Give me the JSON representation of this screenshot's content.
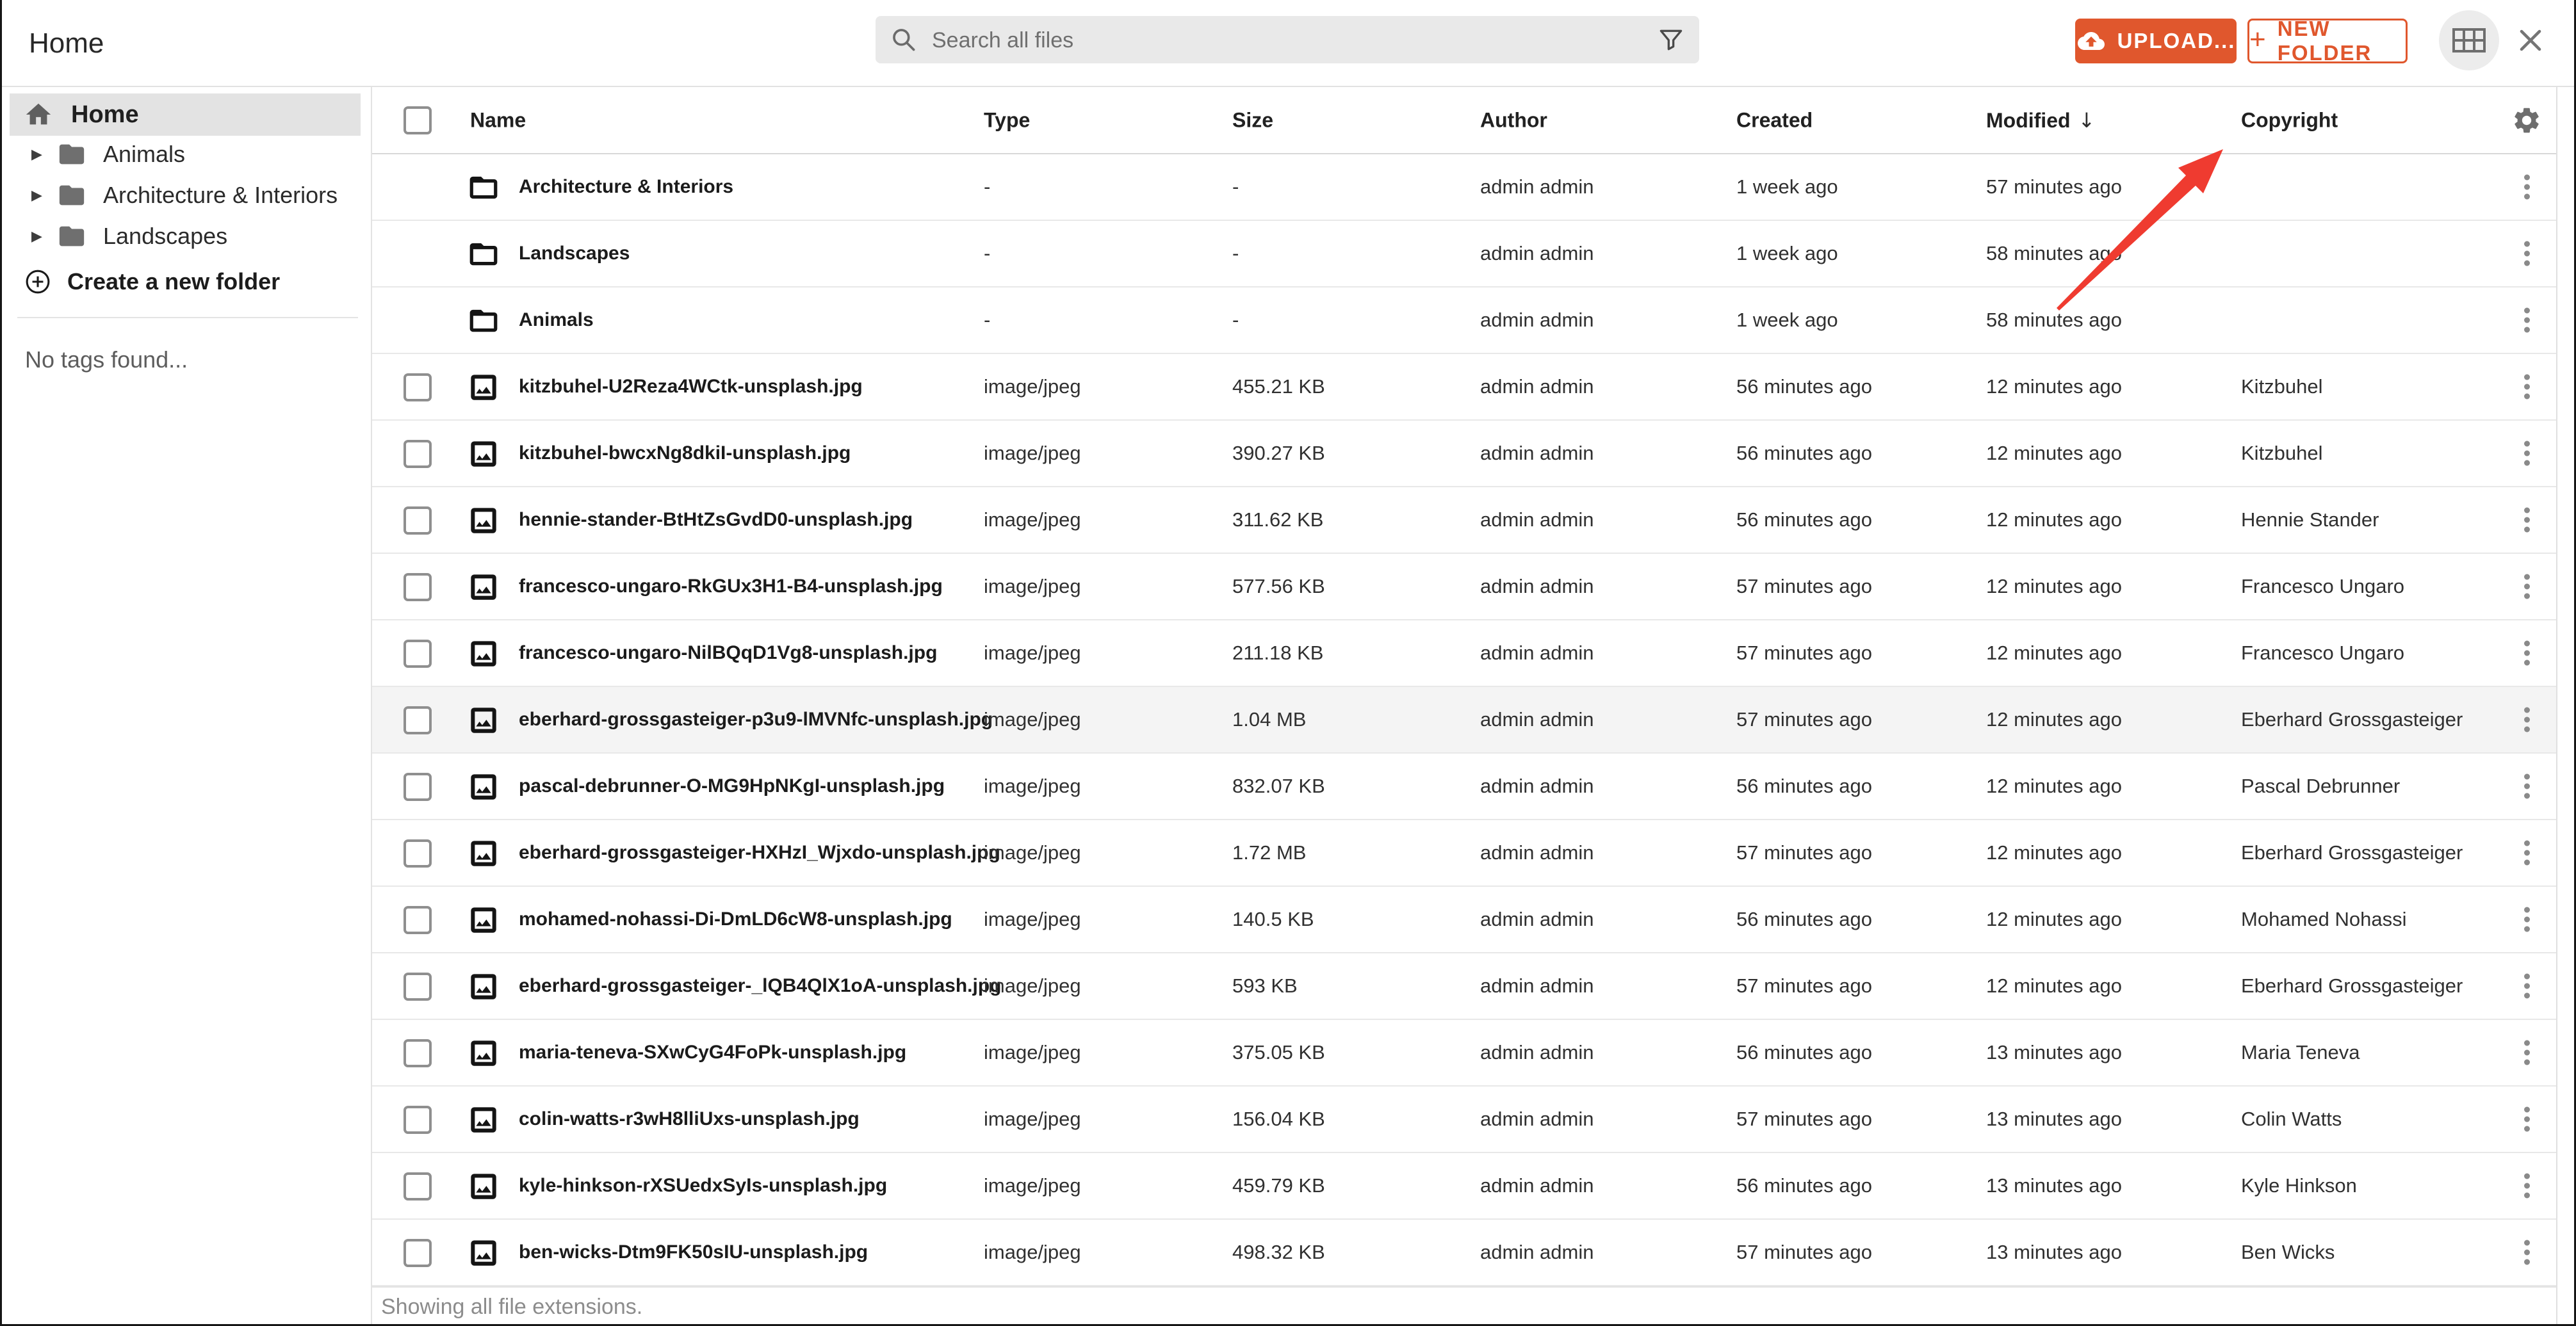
{
  "colors": {
    "accent": "#e0572d",
    "arrow_red": "#ef3b30",
    "selected_bg": "#e3e3e3",
    "hover_row_bg": "#f4f4f4"
  },
  "topbar": {
    "title": "Home",
    "search": {
      "placeholder": "Search all files",
      "value": ""
    },
    "upload_label": "UPLOAD...",
    "new_folder_plus": "+",
    "new_folder_label": "NEW FOLDER"
  },
  "icons": {
    "caret_right": "▶",
    "sort_desc": "↓"
  },
  "sidebar": {
    "home_label": "Home",
    "tree": [
      {
        "label": "Animals"
      },
      {
        "label": "Architecture & Interiors"
      },
      {
        "label": "Landscapes"
      }
    ],
    "create_folder_label": "Create a new folder",
    "no_tags_label": "No tags found..."
  },
  "table": {
    "columns": [
      "Name",
      "Type",
      "Size",
      "Author",
      "Created",
      "Modified",
      "Copyright"
    ],
    "sort_column": "Modified",
    "sort_direction": "desc",
    "rows": [
      {
        "kind": "folder",
        "name": "Architecture & Interiors",
        "type": "-",
        "size": "-",
        "author": "admin admin",
        "created": "1 week ago",
        "modified": "57 minutes ago",
        "copyright": "",
        "highlighted": false
      },
      {
        "kind": "folder",
        "name": "Landscapes",
        "type": "-",
        "size": "-",
        "author": "admin admin",
        "created": "1 week ago",
        "modified": "58 minutes ago",
        "copyright": "",
        "highlighted": false
      },
      {
        "kind": "folder",
        "name": "Animals",
        "type": "-",
        "size": "-",
        "author": "admin admin",
        "created": "1 week ago",
        "modified": "58 minutes ago",
        "copyright": "",
        "highlighted": false
      },
      {
        "kind": "file",
        "name": "kitzbuhel-U2Reza4WCtk-unsplash.jpg",
        "type": "image/jpeg",
        "size": "455.21 KB",
        "author": "admin admin",
        "created": "56 minutes ago",
        "modified": "12 minutes ago",
        "copyright": "Kitzbuhel",
        "highlighted": false
      },
      {
        "kind": "file",
        "name": "kitzbuhel-bwcxNg8dkiI-unsplash.jpg",
        "type": "image/jpeg",
        "size": "390.27 KB",
        "author": "admin admin",
        "created": "56 minutes ago",
        "modified": "12 minutes ago",
        "copyright": "Kitzbuhel",
        "highlighted": false
      },
      {
        "kind": "file",
        "name": "hennie-stander-BtHtZsGvdD0-unsplash.jpg",
        "type": "image/jpeg",
        "size": "311.62 KB",
        "author": "admin admin",
        "created": "56 minutes ago",
        "modified": "12 minutes ago",
        "copyright": "Hennie Stander",
        "highlighted": false
      },
      {
        "kind": "file",
        "name": "francesco-ungaro-RkGUx3H1-B4-unsplash.jpg",
        "type": "image/jpeg",
        "size": "577.56 KB",
        "author": "admin admin",
        "created": "57 minutes ago",
        "modified": "12 minutes ago",
        "copyright": "Francesco Ungaro",
        "highlighted": false
      },
      {
        "kind": "file",
        "name": "francesco-ungaro-NilBQqD1Vg8-unsplash.jpg",
        "type": "image/jpeg",
        "size": "211.18 KB",
        "author": "admin admin",
        "created": "57 minutes ago",
        "modified": "12 minutes ago",
        "copyright": "Francesco Ungaro",
        "highlighted": false
      },
      {
        "kind": "file",
        "name": "eberhard-grossgasteiger-p3u9-lMVNfc-unsplash.jpg",
        "type": "image/jpeg",
        "size": "1.04 MB",
        "author": "admin admin",
        "created": "57 minutes ago",
        "modified": "12 minutes ago",
        "copyright": "Eberhard Grossgasteiger",
        "highlighted": true
      },
      {
        "kind": "file",
        "name": "pascal-debrunner-O-MG9HpNKgI-unsplash.jpg",
        "type": "image/jpeg",
        "size": "832.07 KB",
        "author": "admin admin",
        "created": "56 minutes ago",
        "modified": "12 minutes ago",
        "copyright": "Pascal Debrunner",
        "highlighted": false
      },
      {
        "kind": "file",
        "name": "eberhard-grossgasteiger-HXHzI_Wjxdo-unsplash.jpg",
        "type": "image/jpeg",
        "size": "1.72 MB",
        "author": "admin admin",
        "created": "57 minutes ago",
        "modified": "12 minutes ago",
        "copyright": "Eberhard Grossgasteiger",
        "highlighted": false
      },
      {
        "kind": "file",
        "name": "mohamed-nohassi-Di-DmLD6cW8-unsplash.jpg",
        "type": "image/jpeg",
        "size": "140.5 KB",
        "author": "admin admin",
        "created": "56 minutes ago",
        "modified": "12 minutes ago",
        "copyright": "Mohamed Nohassi",
        "highlighted": false
      },
      {
        "kind": "file",
        "name": "eberhard-grossgasteiger-_lQB4QlX1oA-unsplash.jpg",
        "type": "image/jpeg",
        "size": "593 KB",
        "author": "admin admin",
        "created": "57 minutes ago",
        "modified": "12 minutes ago",
        "copyright": "Eberhard Grossgasteiger",
        "highlighted": false
      },
      {
        "kind": "file",
        "name": "maria-teneva-SXwCyG4FoPk-unsplash.jpg",
        "type": "image/jpeg",
        "size": "375.05 KB",
        "author": "admin admin",
        "created": "56 minutes ago",
        "modified": "13 minutes ago",
        "copyright": "Maria Teneva",
        "highlighted": false
      },
      {
        "kind": "file",
        "name": "colin-watts-r3wH8lliUxs-unsplash.jpg",
        "type": "image/jpeg",
        "size": "156.04 KB",
        "author": "admin admin",
        "created": "57 minutes ago",
        "modified": "13 minutes ago",
        "copyright": "Colin Watts",
        "highlighted": false
      },
      {
        "kind": "file",
        "name": "kyle-hinkson-rXSUedxSyIs-unsplash.jpg",
        "type": "image/jpeg",
        "size": "459.79 KB",
        "author": "admin admin",
        "created": "56 minutes ago",
        "modified": "13 minutes ago",
        "copyright": "Kyle Hinkson",
        "highlighted": false
      },
      {
        "kind": "file",
        "name": "ben-wicks-Dtm9FK50sIU-unsplash.jpg",
        "type": "image/jpeg",
        "size": "498.32 KB",
        "author": "admin admin",
        "created": "57 minutes ago",
        "modified": "13 minutes ago",
        "copyright": "Ben Wicks",
        "highlighted": false
      }
    ],
    "footer": "Showing all file extensions."
  }
}
